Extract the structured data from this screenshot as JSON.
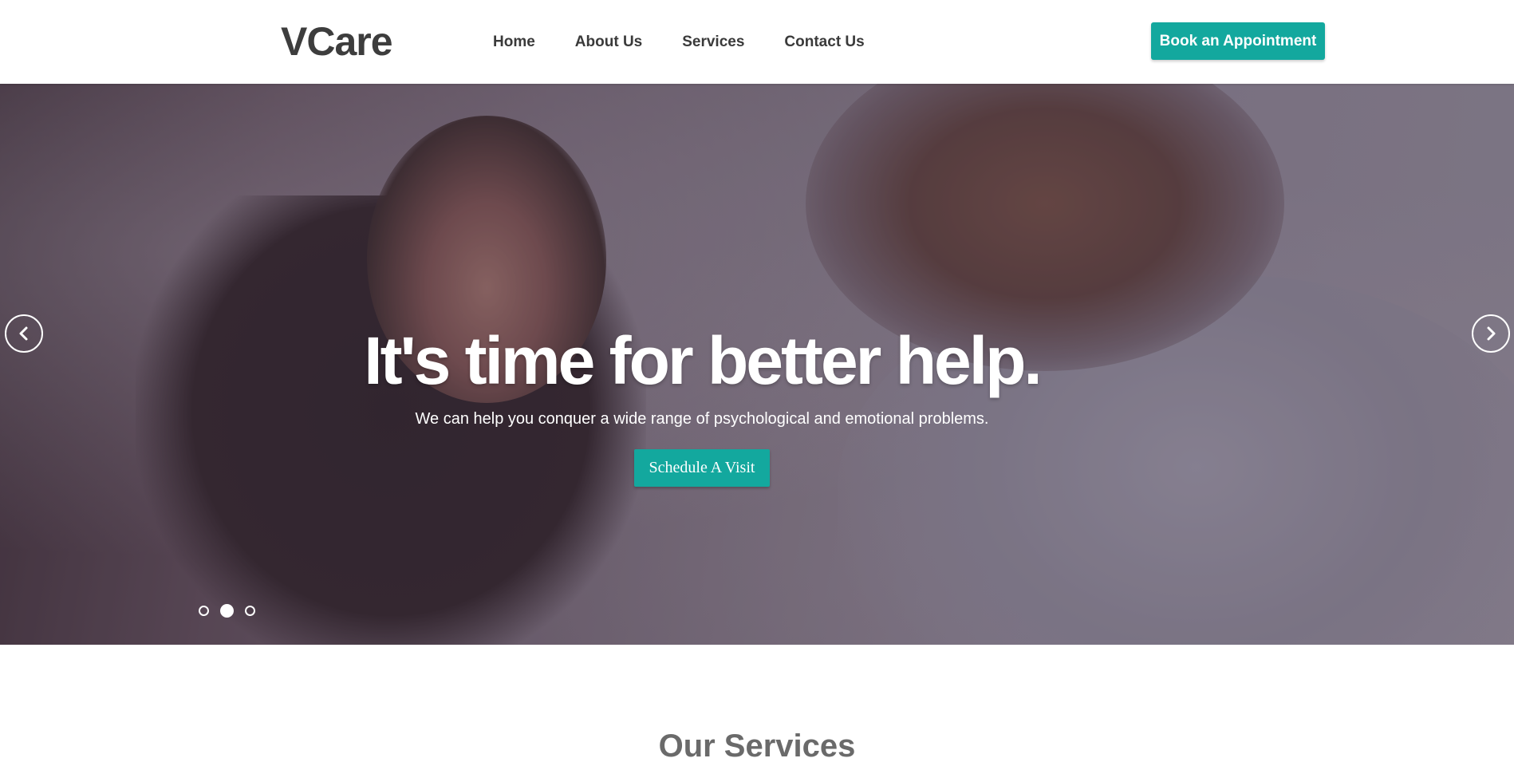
{
  "header": {
    "logo": "VCare",
    "nav": [
      {
        "label": "Home"
      },
      {
        "label": "About Us"
      },
      {
        "label": "Services"
      },
      {
        "label": "Contact Us"
      }
    ],
    "cta_label": "Book an Appointment"
  },
  "hero": {
    "title": "It's time for better help.",
    "subtitle": "We can help you conquer a wide range of psychological and emotional problems.",
    "button_label": "Schedule A Visit",
    "prev_icon": "chevron-left-icon",
    "next_icon": "chevron-right-icon",
    "slides_total": 3,
    "active_slide": 2
  },
  "services": {
    "title": "Our Services"
  },
  "colors": {
    "accent": "#13a89e",
    "text_dark": "#3a3a3a",
    "section_title": "#6a6a6a"
  }
}
